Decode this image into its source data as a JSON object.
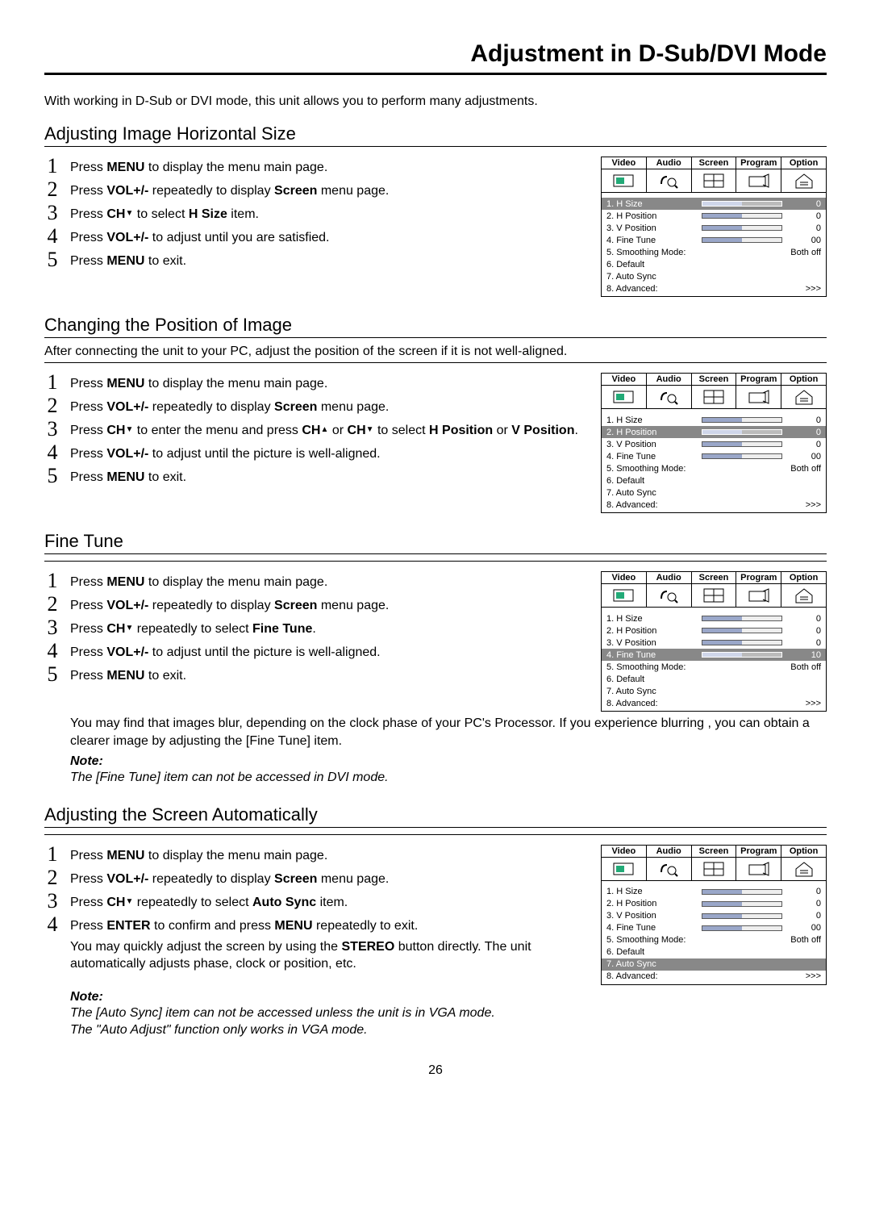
{
  "page_title": "Adjustment in D-Sub/DVI Mode",
  "intro": "With working in D-Sub or DVI mode, this unit allows you to perform many adjustments.",
  "page_number": "26",
  "osd_tabs": {
    "video": "Video",
    "audio": "Audio",
    "screen": "Screen",
    "program": "Program",
    "option": "Option"
  },
  "osd_items": {
    "hsize": "1. H Size",
    "hpos": "2. H Position",
    "vpos": "3. V Position",
    "ftune": "4. Fine Tune",
    "smooth": "5. Smoothing Mode:",
    "default": "6. Default",
    "autosync": "7. Auto Sync",
    "advanced": "8. Advanced:"
  },
  "osd_vals": {
    "zero": "0",
    "zerozero": "00",
    "ten": "10",
    "bothoff": "Both off",
    "more": ">>>"
  },
  "buttons": {
    "menu": "MENU",
    "volpm": "VOL+/-",
    "ch": "CH",
    "enter": "ENTER",
    "stereo": "STEREO"
  },
  "terms": {
    "screen": "Screen",
    "hsize": "H Size",
    "hpos": "H Position",
    "vpos": "V Position",
    "ftune": "Fine Tune",
    "autosync": "Auto Sync"
  },
  "sec1": {
    "heading": "Adjusting Image Horizontal Size",
    "s1a": "Press ",
    "s1b": " to display the menu main page.",
    "s2a": "Press ",
    "s2b": " repeatedly to display ",
    "s2c": " menu page.",
    "s3a": "Press ",
    "s3b": " to select  ",
    "s3c": " item.",
    "s4a": "Press ",
    "s4b": " to adjust until you are satisfied.",
    "s5a": "Press ",
    "s5b": " to exit."
  },
  "sec2": {
    "heading": "Changing the Position of Image",
    "sub": "After connecting the unit to your PC, adjust the position of the screen if it is not well-aligned.",
    "s3a": "Press ",
    "s3b": " to enter the menu and press ",
    "s3c": " or ",
    "s3d": " to select ",
    "s3e": " or ",
    "s3f": ".",
    "s4a": "Press ",
    "s4b": " to adjust until the picture is well-aligned."
  },
  "sec3": {
    "heading": "Fine Tune",
    "s3a": "Press ",
    "s3b": " repeatedly to select ",
    "s3c": ".",
    "extra": "You may find that images blur, depending on the clock phase of your PC's Processor. If you experience blurring , you can obtain a clearer image by adjusting the [Fine Tune] item.",
    "note_label": "Note:",
    "note_text": "The [Fine Tune] item can not be accessed in DVI mode."
  },
  "sec4": {
    "heading": "Adjusting the Screen Automatically",
    "s3a": "Press ",
    "s3b": " repeatedly to select ",
    "s3c": " item.",
    "s4a": "Press ",
    "s4b": " to confirm and press ",
    "s4c": " repeatedly to exit.",
    "extra1": "You may quickly adjust the screen by using the ",
    "extra2": " button directly. The unit automatically adjusts phase, clock or position, etc.",
    "note_label": "Note:",
    "note1": "The [Auto Sync] item can not be accessed unless the unit is in VGA mode.",
    "note2": "The \"Auto Adjust\" function only works in VGA mode."
  }
}
